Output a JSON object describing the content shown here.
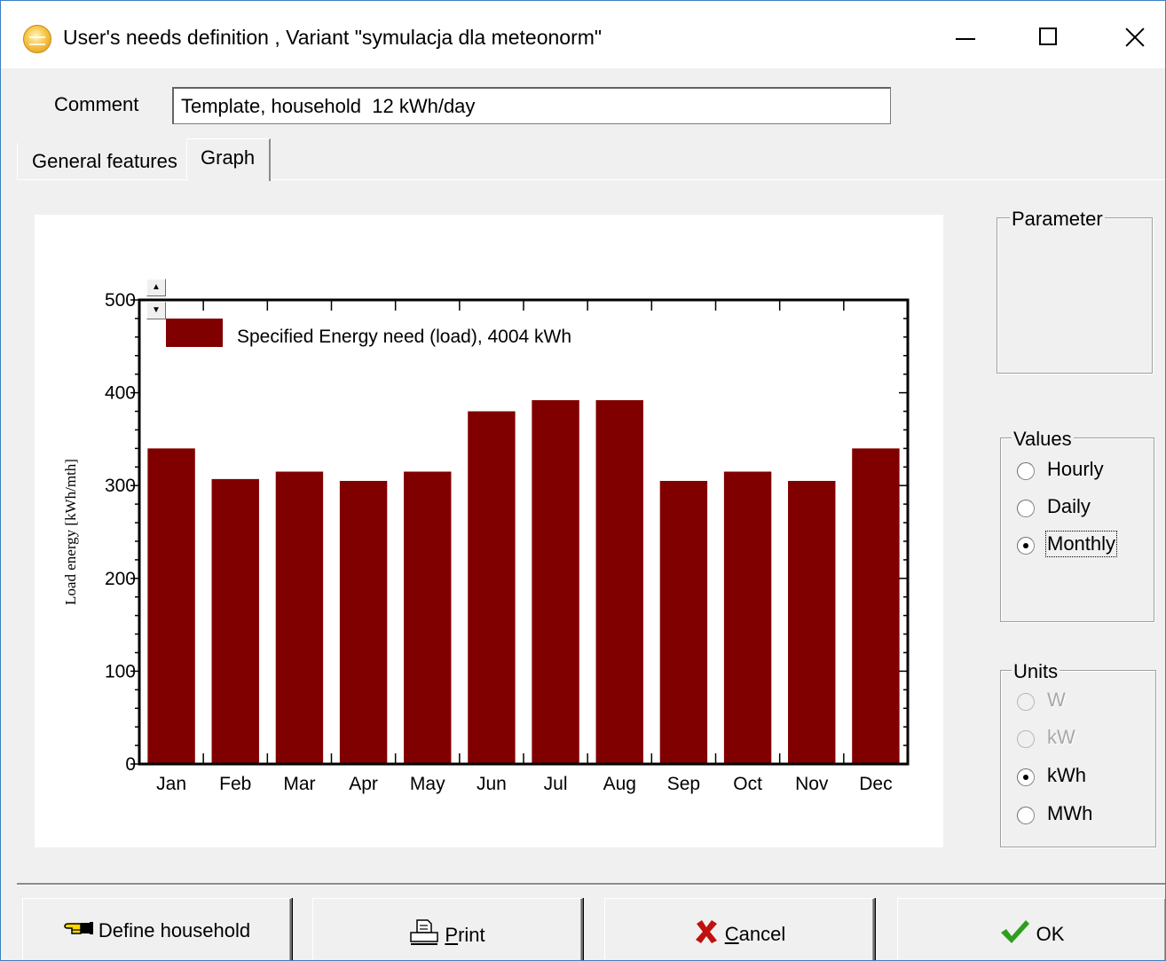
{
  "window": {
    "title": "User's needs definition , Variant  \"symulacja dla meteonorm\""
  },
  "comment": {
    "label": "Comment",
    "value": "Template, household  12 kWh/day"
  },
  "tabs": [
    {
      "label": "General features",
      "selected": false
    },
    {
      "label": "Graph",
      "selected": true
    }
  ],
  "chart_data": {
    "type": "bar",
    "categories": [
      "Jan",
      "Feb",
      "Mar",
      "Apr",
      "May",
      "Jun",
      "Jul",
      "Aug",
      "Sep",
      "Oct",
      "Nov",
      "Dec"
    ],
    "series": [
      {
        "name": "Specified Energy need (load),  4004 kWh",
        "values": [
          340,
          307,
          315,
          305,
          315,
          380,
          392,
          392,
          305,
          315,
          305,
          340
        ],
        "color": "#800000"
      }
    ],
    "ylabel": "Load energy   [kWh/mth]",
    "ylim": [
      0,
      500
    ],
    "yticks": [
      0,
      100,
      200,
      300,
      400,
      500
    ],
    "grid": false,
    "legend_position": "top-left"
  },
  "parameter": {
    "title": "Parameter"
  },
  "values_group": {
    "title": "Values",
    "options": [
      {
        "label": "Hourly",
        "checked": false
      },
      {
        "label": "Daily",
        "checked": false
      },
      {
        "label": "Monthly",
        "checked": true
      }
    ]
  },
  "units_group": {
    "title": "Units",
    "options": [
      {
        "label": "W",
        "checked": false,
        "disabled": true
      },
      {
        "label": "kW",
        "checked": false,
        "disabled": true
      },
      {
        "label": "kWh",
        "checked": true,
        "disabled": false
      },
      {
        "label": "MWh",
        "checked": false,
        "disabled": false
      }
    ]
  },
  "buttons": {
    "define_household": "Define household",
    "print": "Print",
    "cancel": "Cancel",
    "ok": "OK"
  },
  "colors": {
    "bar": "#800000",
    "background": "#f0f0f0",
    "window_border": "#3c7fc4",
    "ok_check": "#2e9e1f",
    "cancel_x": "#c01010"
  }
}
